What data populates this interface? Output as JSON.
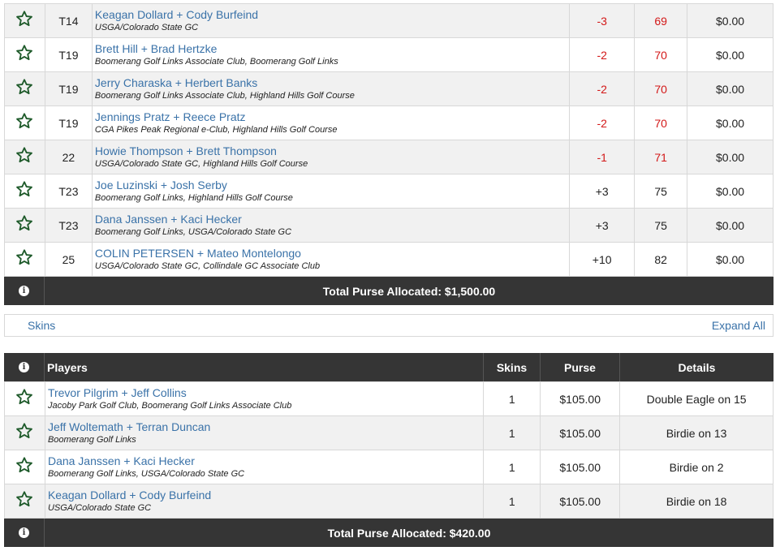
{
  "leaderboard": {
    "rows": [
      {
        "pos": "T14",
        "names": "Keagan Dollard + Cody Burfeind",
        "clubs": "USGA/Colorado State GC",
        "to_par": "-3",
        "score": "69",
        "purse": "$0.00",
        "red": true
      },
      {
        "pos": "T19",
        "names": "Brett Hill + Brad Hertzke",
        "clubs": "Boomerang Golf Links Associate Club, Boomerang Golf Links",
        "to_par": "-2",
        "score": "70",
        "purse": "$0.00",
        "red": true
      },
      {
        "pos": "T19",
        "names": "Jerry Charaska + Herbert Banks",
        "clubs": "Boomerang Golf Links Associate Club, Highland Hills Golf Course",
        "to_par": "-2",
        "score": "70",
        "purse": "$0.00",
        "red": true
      },
      {
        "pos": "T19",
        "names": "Jennings Pratz + Reece Pratz",
        "clubs": "CGA Pikes Peak Regional e-Club, Highland Hills Golf Course",
        "to_par": "-2",
        "score": "70",
        "purse": "$0.00",
        "red": true
      },
      {
        "pos": "22",
        "names": "Howie Thompson + Brett Thompson",
        "clubs": "USGA/Colorado State GC, Highland Hills Golf Course",
        "to_par": "-1",
        "score": "71",
        "purse": "$0.00",
        "red": true
      },
      {
        "pos": "T23",
        "names": "Joe Luzinski + Josh Serby",
        "clubs": "Boomerang Golf Links, Highland Hills Golf Course",
        "to_par": "+3",
        "score": "75",
        "purse": "$0.00",
        "red": false
      },
      {
        "pos": "T23",
        "names": "Dana Janssen + Kaci Hecker",
        "clubs": "Boomerang Golf Links, USGA/Colorado State GC",
        "to_par": "+3",
        "score": "75",
        "purse": "$0.00",
        "red": false
      },
      {
        "pos": "25",
        "names": "COLIN PETERSEN + Mateo Montelongo",
        "clubs": "USGA/Colorado State GC, Collindale GC Associate Club",
        "to_par": "+10",
        "score": "82",
        "purse": "$0.00",
        "red": false
      }
    ],
    "total": "Total Purse Allocated: $1,500.00"
  },
  "skins_bar": {
    "label": "Skins",
    "expand": "Expand All"
  },
  "skins": {
    "headers": {
      "players": "Players",
      "skins": "Skins",
      "purse": "Purse",
      "details": "Details"
    },
    "rows": [
      {
        "names": "Trevor Pilgrim + Jeff Collins",
        "clubs": "Jacoby Park Golf Club, Boomerang Golf Links Associate Club",
        "skins": "1",
        "purse": "$105.00",
        "details": "Double Eagle on 15"
      },
      {
        "names": "Jeff Woltemath + Terran Duncan",
        "clubs": "Boomerang Golf Links",
        "skins": "1",
        "purse": "$105.00",
        "details": "Birdie on 13"
      },
      {
        "names": "Dana Janssen + Kaci Hecker",
        "clubs": "Boomerang Golf Links, USGA/Colorado State GC",
        "skins": "1",
        "purse": "$105.00",
        "details": "Birdie on 2"
      },
      {
        "names": "Keagan Dollard + Cody Burfeind",
        "clubs": "USGA/Colorado State GC",
        "skins": "1",
        "purse": "$105.00",
        "details": "Birdie on 18"
      }
    ],
    "total": "Total Purse Allocated: $420.00"
  },
  "info_icon": "i",
  "icons": {
    "favorite": "star-outline-icon",
    "info": "info-icon"
  },
  "colors": {
    "link": "#3a72a8",
    "negative": "#d31818",
    "header_bg": "#353535",
    "star": "#1e5a2a"
  }
}
